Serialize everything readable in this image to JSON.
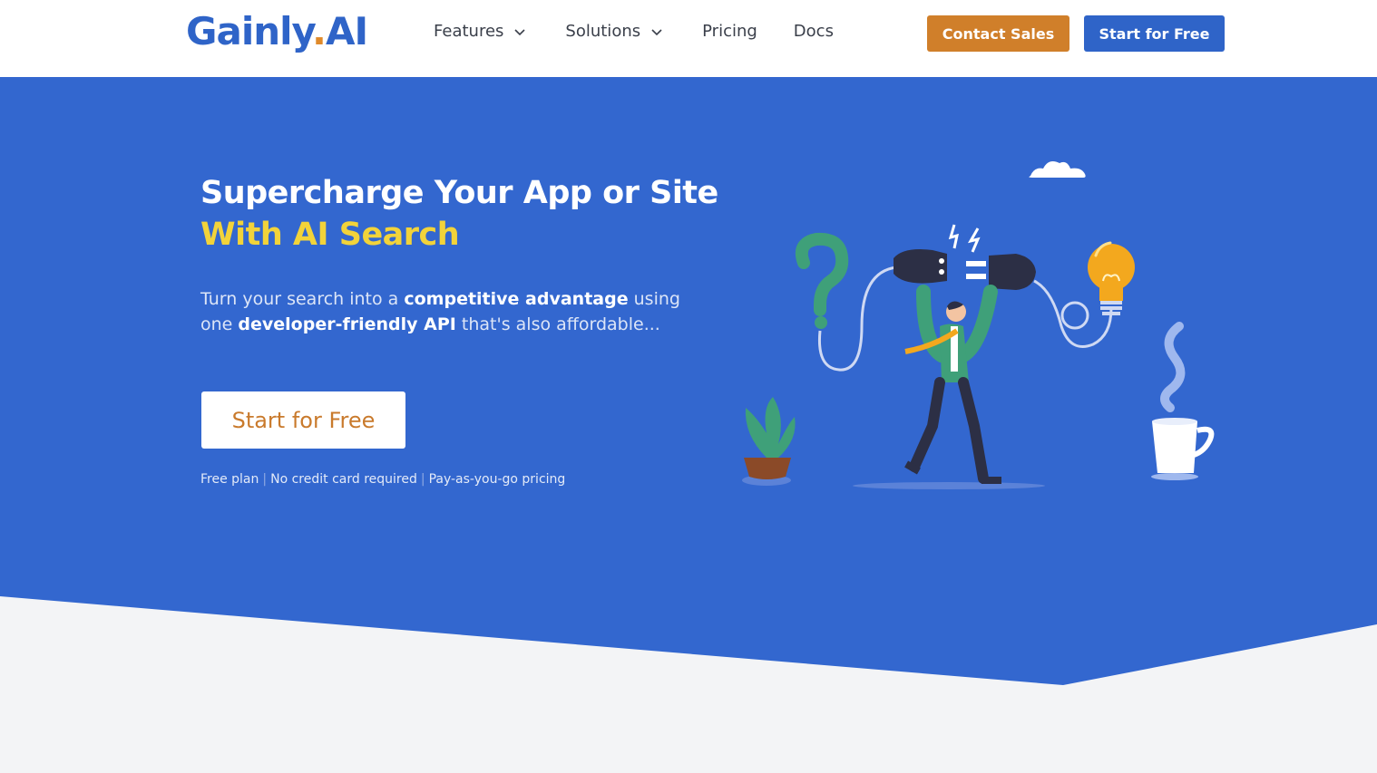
{
  "brand": {
    "logo_main": "Gainly",
    "logo_dot": ".",
    "logo_suffix": "AI"
  },
  "nav": {
    "items": [
      {
        "label": "Features",
        "has_dropdown": true
      },
      {
        "label": "Solutions",
        "has_dropdown": true
      },
      {
        "label": "Pricing",
        "has_dropdown": false
      },
      {
        "label": "Docs",
        "has_dropdown": false
      }
    ],
    "contact_label": "Contact Sales",
    "start_label": "Start for Free"
  },
  "hero": {
    "title_line1": "Supercharge Your App or Site",
    "title_line2": "With AI Search",
    "sub_part1": "Turn your search into a ",
    "sub_bold1": "competitive advantage",
    "sub_part2": " using one ",
    "sub_bold2": "developer-friendly API",
    "sub_part3": " that's also affordable...",
    "cta_label": "Start for Free",
    "notes": [
      "Free plan",
      "No credit card required",
      "Pay-as-you-go pricing"
    ]
  },
  "colors": {
    "brand_blue": "#2f64c8",
    "hero_blue": "#3367cf",
    "orange": "#d07f2a",
    "accent_yellow": "#f2d33a",
    "page_bg": "#f3f4f6"
  },
  "icons": {
    "chevron": "chevron-down-icon",
    "illustration": "hero-illustration"
  }
}
